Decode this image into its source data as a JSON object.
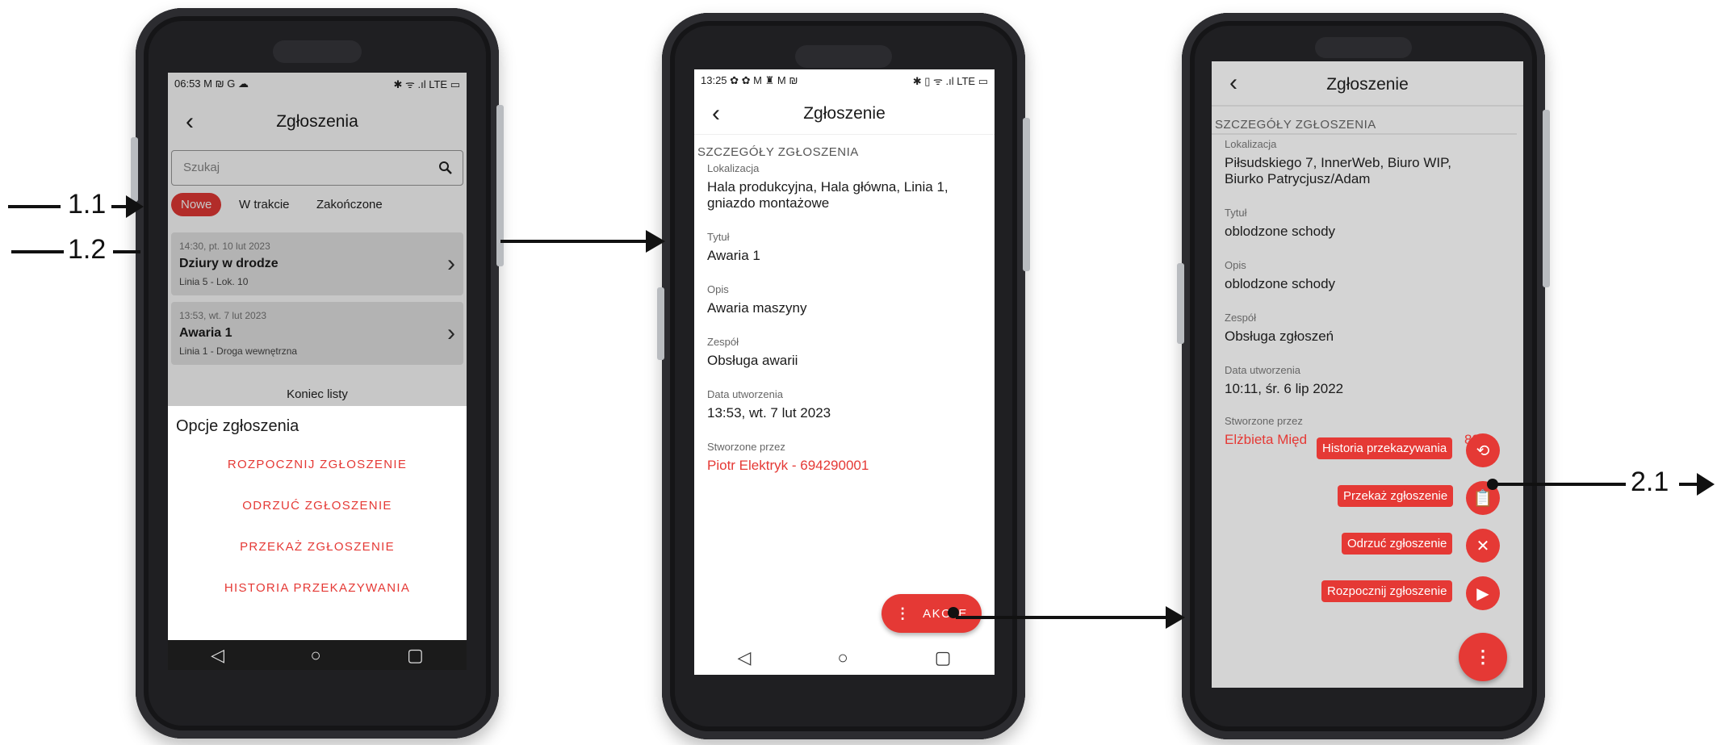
{
  "annotations": {
    "label_1_1": "1.1",
    "label_1_2": "1.2",
    "label_2_1": "2.1"
  },
  "screen1": {
    "status_time": "06:53",
    "status_icons_left": "M ₪ G ☁",
    "status_icons_right": "✱ ᯤ .ıl LTE ▭",
    "title": "Zgłoszenia",
    "search_placeholder": "Szukaj",
    "tabs": [
      "Nowe",
      "W trakcie",
      "Zakończone"
    ],
    "items": [
      {
        "time": "14:30, pt. 10 lut 2023",
        "name": "Dziury w drodze",
        "location": "Linia 5 - Lok. 10"
      },
      {
        "time": "13:53, wt. 7 lut 2023",
        "name": "Awaria 1",
        "location": "Linia 1 - Droga wewnętrzna"
      }
    ],
    "end_of_list": "Koniec listy",
    "sheet_title": "Opcje zgłoszenia",
    "options": [
      "ROZPOCZNIJ ZGŁOSZENIE",
      "ODRZUĆ ZGŁOSZENIE",
      "PRZEKAŻ ZGŁOSZENIE",
      "HISTORIA PRZEKAZYWANIA"
    ]
  },
  "screen2": {
    "status_time": "13:25",
    "status_icons_left": "✿ ✿ M ♜ M ₪",
    "status_icons_right": "✱ ▯ ᯤ .ıl LTE ▭",
    "title": "Zgłoszenie",
    "section": "SZCZEGÓŁY ZGŁOSZENIA",
    "fields": [
      {
        "label": "Lokalizacja",
        "value": "Hala produkcyjna, Hala główna, Linia 1, gniazdo montażowe"
      },
      {
        "label": "Tytuł",
        "value": "Awaria 1"
      },
      {
        "label": "Opis",
        "value": "Awaria maszyny"
      },
      {
        "label": "Zespół",
        "value": "Obsługa awarii"
      },
      {
        "label": "Data utworzenia",
        "value": "13:53, wt. 7 lut 2023"
      },
      {
        "label": "Stworzone przez",
        "value": "Piotr Elektryk - 694290001"
      }
    ],
    "fab_label": "AKCJE"
  },
  "screen3": {
    "title": "Zgłoszenie",
    "section": "SZCZEGÓŁY ZGŁOSZENIA",
    "fields": [
      {
        "label": "Lokalizacja",
        "value": "Piłsudskiego 7, InnerWeb, Biuro WIP, Biurko Patrycjusz/Adam"
      },
      {
        "label": "Tytuł",
        "value": "oblodzone schody"
      },
      {
        "label": "Opis",
        "value": "oblodzone schody"
      },
      {
        "label": "Zespół",
        "value": "Obsługa zgłoszeń"
      },
      {
        "label": "Data utworzenia",
        "value": "10:11, śr. 6 lip 2022"
      },
      {
        "label": "Stworzone przez",
        "value": "Elżbieta Międ"
      }
    ],
    "created_by_suffix": "89",
    "actions": [
      "Historia przekazywania",
      "Przekaż zgłoszenie",
      "Odrzuć zgłoszenie",
      "Rozpocznij zgłoszenie"
    ]
  },
  "colors": {
    "accent": "#e53935",
    "phone_body": "#1f1f22",
    "dim_overlay": "rgba(0,0,0,0.22)"
  }
}
